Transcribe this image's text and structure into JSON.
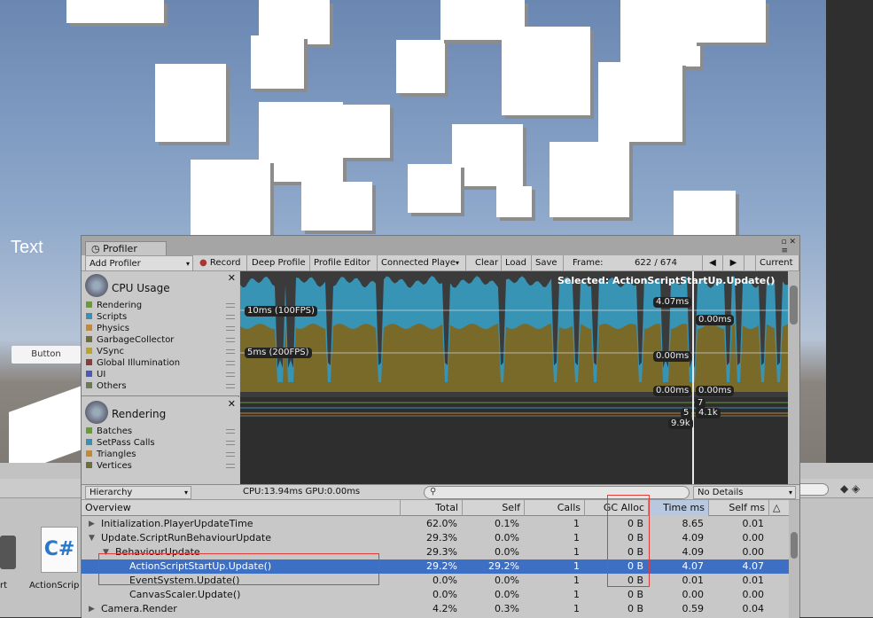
{
  "scene": {
    "canvas_text": "Text",
    "canvas_button": "Button"
  },
  "project": {
    "assets": [
      {
        "label": "rt"
      },
      {
        "label": "ActionScrip",
        "icon": "csharp-script-icon"
      }
    ]
  },
  "profiler": {
    "tab_title": "Profiler",
    "toolbar": {
      "add_profiler": "Add Profiler",
      "record": "Record",
      "deep_profile": "Deep Profile",
      "profile_editor": "Profile Editor",
      "connected_player": "Connected Playe",
      "clear": "Clear",
      "load": "Load",
      "save": "Save",
      "frame_label": "Frame:",
      "frame_value": "622 / 674",
      "current": "Current"
    },
    "cpu_module": {
      "title": "CPU Usage",
      "legend": [
        {
          "label": "Rendering",
          "color": "#6b9a3c"
        },
        {
          "label": "Scripts",
          "color": "#3b8fb5"
        },
        {
          "label": "Physics",
          "color": "#c08a3e"
        },
        {
          "label": "GarbageCollector",
          "color": "#6e6e3a"
        },
        {
          "label": "VSync",
          "color": "#b8a23a"
        },
        {
          "label": "Global Illumination",
          "color": "#8a3c3c"
        },
        {
          "label": "UI",
          "color": "#4f5aa8"
        },
        {
          "label": "Others",
          "color": "#6d7b52"
        }
      ]
    },
    "rendering_module": {
      "title": "Rendering",
      "legend": [
        {
          "label": "Batches",
          "color": "#6b9a3c"
        },
        {
          "label": "SetPass Calls",
          "color": "#3b8fb5"
        },
        {
          "label": "Triangles",
          "color": "#c08a3e"
        },
        {
          "label": "Vertices",
          "color": "#6e6e3a"
        }
      ]
    },
    "graph": {
      "selected": "Selected: ActionScriptStartUp.Update()",
      "line_100fps": "10ms (100FPS)",
      "line_200fps": "5ms (200FPS)",
      "val_a": "4.07ms",
      "val_b": "0.00ms",
      "val_c": "0.00ms",
      "val_d": "0.00ms",
      "val_e": "0.00ms",
      "rend_7": "7",
      "rend_5": "5",
      "rend_41k": "4.1k",
      "rend_99k": "9.9k",
      "colors": {
        "scripts": "#3794b5",
        "rendering": "#7a6a2a",
        "bg": "#3b3b3b"
      }
    },
    "midbar": {
      "view": "Hierarchy",
      "cpu_gpu": "CPU:13.94ms   GPU:0.00ms",
      "details": "No Details"
    },
    "table": {
      "headers": [
        "Overview",
        "Total",
        "Self",
        "Calls",
        "GC Alloc",
        "Time ms",
        "Self ms"
      ],
      "rows": [
        {
          "name": "Initialization.PlayerUpdateTime",
          "total": "62.0%",
          "self": "0.1%",
          "calls": "1",
          "gc": "0 B",
          "time": "8.65",
          "selfms": "0.01",
          "depth": 0,
          "arrow": "right"
        },
        {
          "name": "Update.ScriptRunBehaviourUpdate",
          "total": "29.3%",
          "self": "0.0%",
          "calls": "1",
          "gc": "0 B",
          "time": "4.09",
          "selfms": "0.00",
          "depth": 0,
          "arrow": "down"
        },
        {
          "name": "BehaviourUpdate",
          "total": "29.3%",
          "self": "0.0%",
          "calls": "1",
          "gc": "0 B",
          "time": "4.09",
          "selfms": "0.00",
          "depth": 1,
          "arrow": "down"
        },
        {
          "name": "ActionScriptStartUp.Update()",
          "total": "29.2%",
          "self": "29.2%",
          "calls": "1",
          "gc": "0 B",
          "time": "4.07",
          "selfms": "4.07",
          "depth": 2,
          "arrow": "",
          "selected": true
        },
        {
          "name": "EventSystem.Update()",
          "total": "0.0%",
          "self": "0.0%",
          "calls": "1",
          "gc": "0 B",
          "time": "0.01",
          "selfms": "0.01",
          "depth": 2,
          "arrow": ""
        },
        {
          "name": "CanvasScaler.Update()",
          "total": "0.0%",
          "self": "0.0%",
          "calls": "1",
          "gc": "0 B",
          "time": "0.00",
          "selfms": "0.00",
          "depth": 2,
          "arrow": ""
        },
        {
          "name": "Camera.Render",
          "total": "4.2%",
          "self": "0.3%",
          "calls": "1",
          "gc": "0 B",
          "time": "0.59",
          "selfms": "0.04",
          "depth": 0,
          "arrow": "right"
        }
      ]
    }
  }
}
